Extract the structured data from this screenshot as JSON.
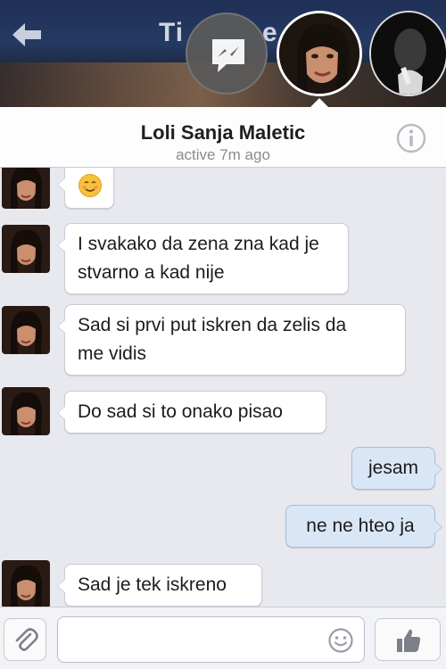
{
  "chat_heads": {
    "title_fragment_1": "Ti",
    "title_fragment_2": "e",
    "icons": [
      "back-arrow-icon",
      "messenger-icon",
      "profile-photo",
      "other-chat-head-photo"
    ]
  },
  "header": {
    "contact_name": "Loli Sanja Maletic",
    "status": "active 7m ago",
    "info_icon": "info-icon"
  },
  "messages": [
    {
      "direction": "in",
      "text": "☺",
      "kind": "emoji"
    },
    {
      "direction": "in",
      "line1": "I svakako da zena zna kad je",
      "line2": "stvarno a kad nije"
    },
    {
      "direction": "in",
      "line1": "Sad si prvi put iskren da zelis da",
      "line2": "me vidis"
    },
    {
      "direction": "in",
      "text": "Do sad si to onako pisao"
    },
    {
      "direction": "out",
      "text": "jesam"
    },
    {
      "direction": "out",
      "text": "ne ne hteo ja"
    },
    {
      "direction": "in",
      "text": "Sad je tek iskreno"
    }
  ],
  "composer": {
    "placeholder": "",
    "attach_icon": "paperclip-icon",
    "emoji_icon": "smiley-icon",
    "like_icon": "thumbs-up-icon"
  },
  "colors": {
    "incoming_bubble": "#ffffff",
    "outgoing_bubble": "#d9e6f6",
    "thread_background": "#e8e9ef"
  }
}
